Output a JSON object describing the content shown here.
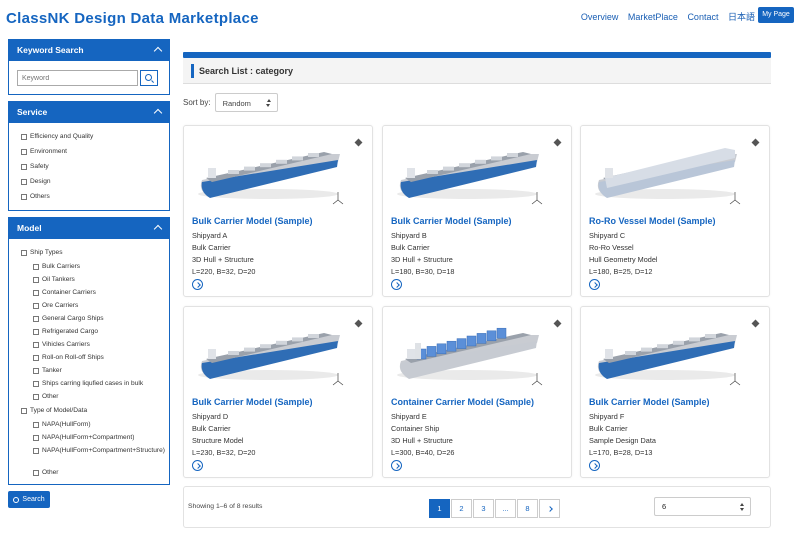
{
  "header": {
    "logo": "ClassNK Design Data Marketplace",
    "nav": [
      "Overview",
      "MarketPlace",
      "Contact",
      "日本語"
    ],
    "mypage": "My Page"
  },
  "sidebar": {
    "keyword": {
      "title": "Keyword Search",
      "placeholder": "Keyword"
    },
    "service": {
      "title": "Service",
      "items": [
        "Efficiency and Quality",
        "Environment",
        "Safety",
        "Design",
        "Others"
      ]
    },
    "model": {
      "title": "Model",
      "ship_types_label": "Ship Types",
      "ship_types": [
        "Bulk Carriers",
        "Oil Tankers",
        "Container Carriers",
        "Ore Carriers",
        "General Cargo Ships",
        "Refrigerated Cargo",
        "Vihicles Carriers",
        "Roll-on Roll-off Ships",
        "Tanker",
        "Ships carring liqufied cases in bulk",
        "Other"
      ],
      "data_types_label": "Type of Model/Data",
      "data_types": [
        "NAPA(HullForm)",
        "NAPA(HullForm+Compartment)",
        "NAPA(HullForm+Compartment+Structure)",
        "Other"
      ]
    },
    "search_button": "Search"
  },
  "main": {
    "title": "Search List : category",
    "sort_label": "Sort by:",
    "sort_value": "Random",
    "cards": [
      {
        "name": "Bulk Carrier Model (Sample)",
        "shipyard": "Shipyard A",
        "type": "Bulk Carrier",
        "model": "3D Hull + Structure",
        "dims": "L=220, B=32, D=20",
        "icon": "bulk-carrier-icon"
      },
      {
        "name": "Bulk Carrier Model (Sample)",
        "shipyard": "Shipyard B",
        "type": "Bulk Carrier",
        "model": "3D Hull + Structure",
        "dims": "L=180, B=30, D=18",
        "icon": "bulk-carrier-icon"
      },
      {
        "name": "Ro-Ro Vessel Model (Sample)",
        "shipyard": "Shipyard C",
        "type": "Ro-Ro Vessel",
        "model": "Hull Geometry Model",
        "dims": "L=180, B=25, D=12",
        "icon": "roro-vessel-icon"
      },
      {
        "name": "Bulk Carrier Model (Sample)",
        "shipyard": "Shipyard D",
        "type": "Bulk Carrier",
        "model": "Structure Model",
        "dims": "L=230, B=32, D=20",
        "icon": "bulk-carrier-icon"
      },
      {
        "name": "Container Carrier Model (Sample)",
        "shipyard": "Shipyard E",
        "type": "Container Ship",
        "model": "3D Hull + Structure",
        "dims": "L=300, B=40, D=26",
        "icon": "container-ship-icon"
      },
      {
        "name": "Bulk Carrier Model (Sample)",
        "shipyard": "Shipyard F",
        "type": "Bulk Carrier",
        "model": "Sample Design Data",
        "dims": "L=170, B=28, D=13",
        "icon": "bulk-carrier-icon"
      }
    ],
    "pagination": {
      "showing": "Showing 1–6 of 8 results",
      "pages": [
        "1",
        "2",
        "3",
        "...",
        "8"
      ],
      "active": "1",
      "per_page": "6"
    }
  },
  "colors": {
    "brand": "#1565c0",
    "hull_blue": "#2f6db5",
    "deck_gray": "#b9bec6"
  }
}
